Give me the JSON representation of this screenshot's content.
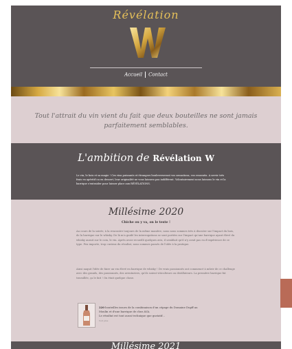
{
  "brand": {
    "wordmark": "Révélation",
    "logo_letters": "W"
  },
  "nav": {
    "items": [
      "Accueil",
      "Contact"
    ]
  },
  "quote": {
    "text": "Tout l'attrait du vin vient du fait que deux bouteilles ne sont jamais parfaitement semblables."
  },
  "ambition": {
    "title_script": "L'ambition de",
    "title_bold": "Révélation",
    "title_mark": "W",
    "text": "Le vin, le bois et sa magie ! Ces vins puissants et étrangers bouleverseront vos sensations, vos ressentis. A servir très frais en apéritif ou en dessert, leur originalité ne vous laissera pas indifférent. Volontairement nous laissons le vin et la barrique s'entraider pour laisser place aux RÉVÉLATIONS."
  },
  "millesime": {
    "title": "Millésime 2020",
    "subtitle": "Chiche ou y va, on le teste !",
    "p1": "Au cours de la soirée, à la rencontre toujours de la même manière, nous nous sommes très à discuter sur l'impact du bois, de la barrique sur le whisky. De là m'a guidé les interrogations se sont portées sur l'impact qu'une barrique ayant élevé du whisky aurait sur le coin, le vin. Après avoir recueilli quelques avis, il semblait qu'il n'y avait pas eu d'expérience de ce type. Peu importe, trop curieux du résultat, nous sommes passés de l'idée à la pratique.",
    "p2": "Ainsi naquit l'idée de faire un vin élevé en barrique de whisky ! De vrais passionnés ont commencé à mûrir de ce challenge avec des grands, des passionnés, des aventuriers, qu'ils soient viticulteurs ou distillateurs. La première barrique fut travaillée, ça le fait ! On était quelque chose.",
    "caption_bold": "220",
    "caption_line1": "bouteilles issues de la combinaison d'un cépage du Domaine Dupff au",
    "caption_line2": "Moulin et d'une barrique de chez AVA.",
    "caption_line3": "Le résultat est tout aussi technique que gustatif...",
    "caption_small": "Voir plus"
  },
  "next_section": {
    "title": "Millésime 2021"
  },
  "colors": {
    "dark": "#5a5456",
    "pink": "#ddcfd1",
    "gold": "#d6a942"
  },
  "icons": {
    "logo": "ww-gold-logo",
    "bottle": "wine-bottle-image"
  }
}
